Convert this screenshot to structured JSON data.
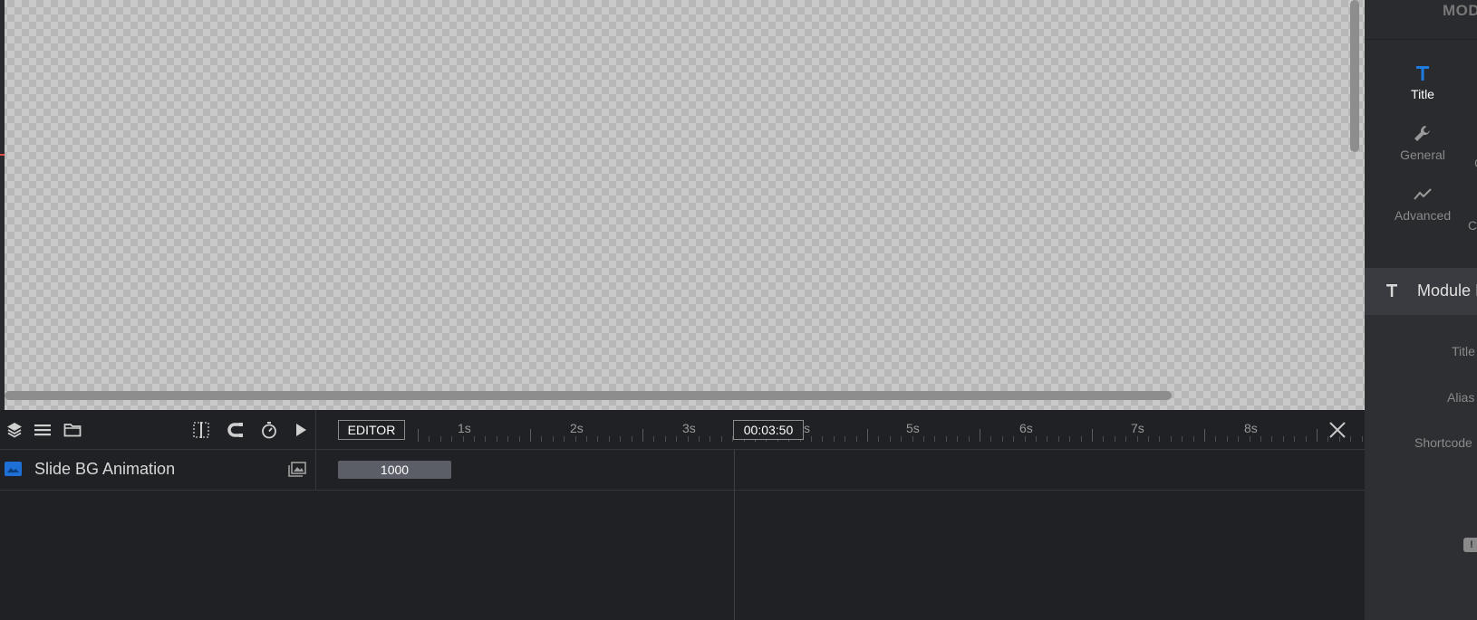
{
  "timeline": {
    "editor_label": "EDITOR",
    "current_time": "00:03:50",
    "ruler_labels": [
      "1s",
      "2s",
      "3s",
      "s",
      "5s",
      "6s",
      "7s",
      "8s"
    ],
    "layer": {
      "name": "Slide BG Animation",
      "bar_value": "1000"
    },
    "toolbar_icons": [
      "layers-icon",
      "list-icon",
      "folder-icon",
      "split-icon",
      "magnet-icon",
      "stopwatch-icon",
      "play-icon"
    ]
  },
  "right_panel": {
    "header": "MOD",
    "tabs": [
      {
        "label": "Title",
        "icon": "text-title-icon",
        "active": true
      },
      {
        "label": "General",
        "icon": "wrench-icon",
        "active": false
      },
      {
        "label": "Advanced",
        "icon": "trend-line-icon",
        "active": false
      }
    ],
    "clipped_tab_labels": [
      "C",
      "C"
    ],
    "section_title": "Module I",
    "fields": {
      "title_label": "Title",
      "alias_label": "Alias",
      "shortcode_label": "Shortcode"
    },
    "badge": "!"
  },
  "colors": {
    "accent": "#1e6fd6",
    "panel_bg": "#2a2b2e",
    "timeline_bg": "#202124"
  }
}
